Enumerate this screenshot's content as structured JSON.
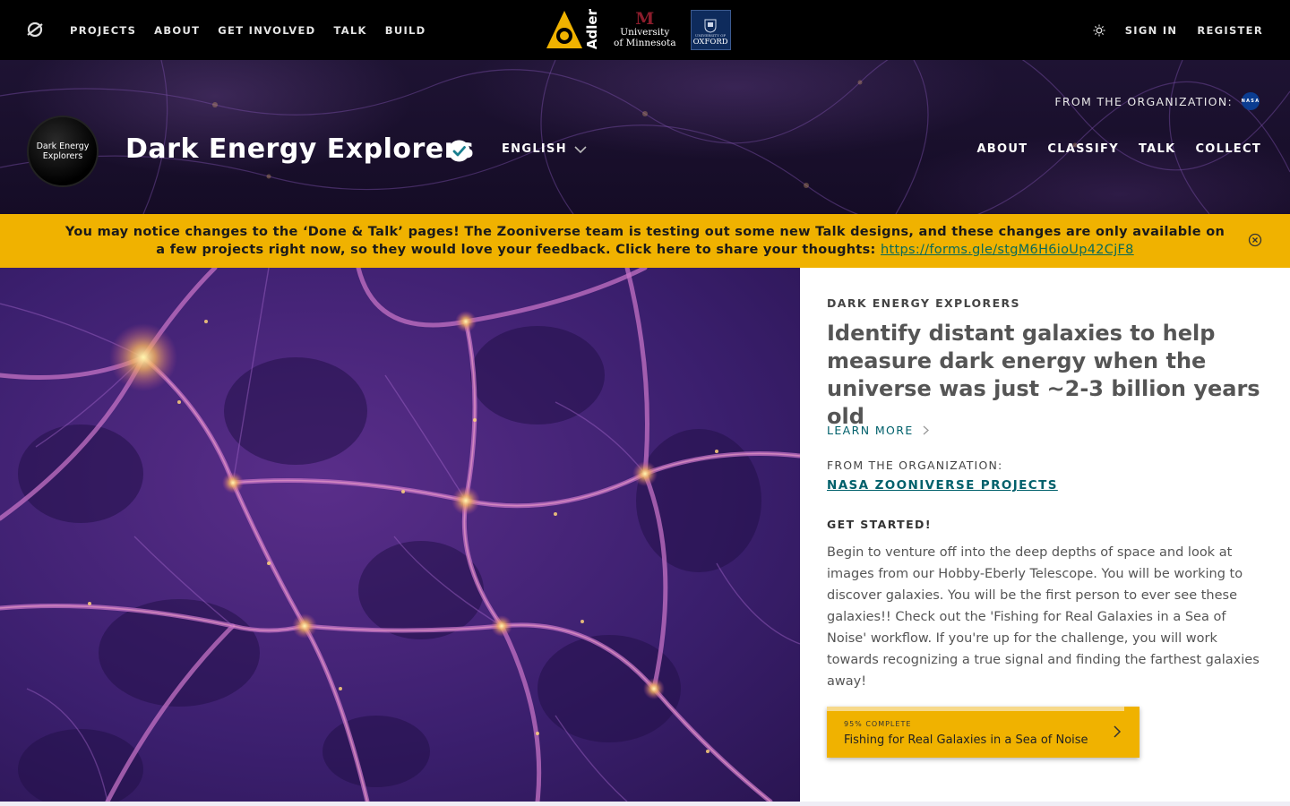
{
  "topbar": {
    "nav": [
      "PROJECTS",
      "ABOUT",
      "GET INVOLVED",
      "TALK",
      "BUILD"
    ],
    "partners": {
      "adler": "Adler",
      "umn_line1": "University",
      "umn_line2": "of Minnesota",
      "oxford_small": "UNIVERSITY OF",
      "oxford_big": "OXFORD"
    },
    "sign_in": "SIGN IN",
    "register": "REGISTER",
    "icons": [
      "zooniverse-logo-icon",
      "sun-icon"
    ]
  },
  "project": {
    "avatar_text": "Dark Energy Explorers",
    "title": "Dark Energy Explorers",
    "language": "ENGLISH",
    "from_org_label": "FROM THE ORGANIZATION:",
    "nasa_badge": "NASA",
    "nav": [
      "ABOUT",
      "CLASSIFY",
      "TALK",
      "COLLECT"
    ]
  },
  "banner": {
    "text": "You may notice changes to the ‘Done & Talk’ pages! The Zooniverse team is testing out some new Talk designs, and these changes are only available on a few projects right now, so they would love your feedback. Click here to share your thoughts: ",
    "link": "https://forms.gle/stgM6H6ioUp42CjF8"
  },
  "panel": {
    "eyebrow": "DARK ENERGY EXPLORERS",
    "headline": "Identify distant galaxies to help measure dark energy when the universe was just ~2-3 billion years old",
    "learn_more": "LEARN MORE",
    "from_org_label": "FROM THE ORGANIZATION:",
    "org_link": "NASA ZOONIVERSE PROJECTS",
    "get_started": "GET STARTED!",
    "description": "Begin to venture off into the deep depths of space and look at images from our Hobby-Eberly Telescope. You will be working to discover galaxies. You will be the first person to ever see these galaxies!! Check out the 'Fishing for Real Galaxies in a Sea of Noise' workflow. If you're up for the challenge, you will work towards recognizing a true signal and finding the farthest galaxies away!",
    "workflow": {
      "percent_label": "95% COMPLETE",
      "percent": 95,
      "name": "Fishing for Real Galaxies in a Sea of Noise"
    }
  },
  "colors": {
    "accent_yellow": "#f0b200",
    "teal_link": "#00606b",
    "topbar_bg": "#000000"
  }
}
